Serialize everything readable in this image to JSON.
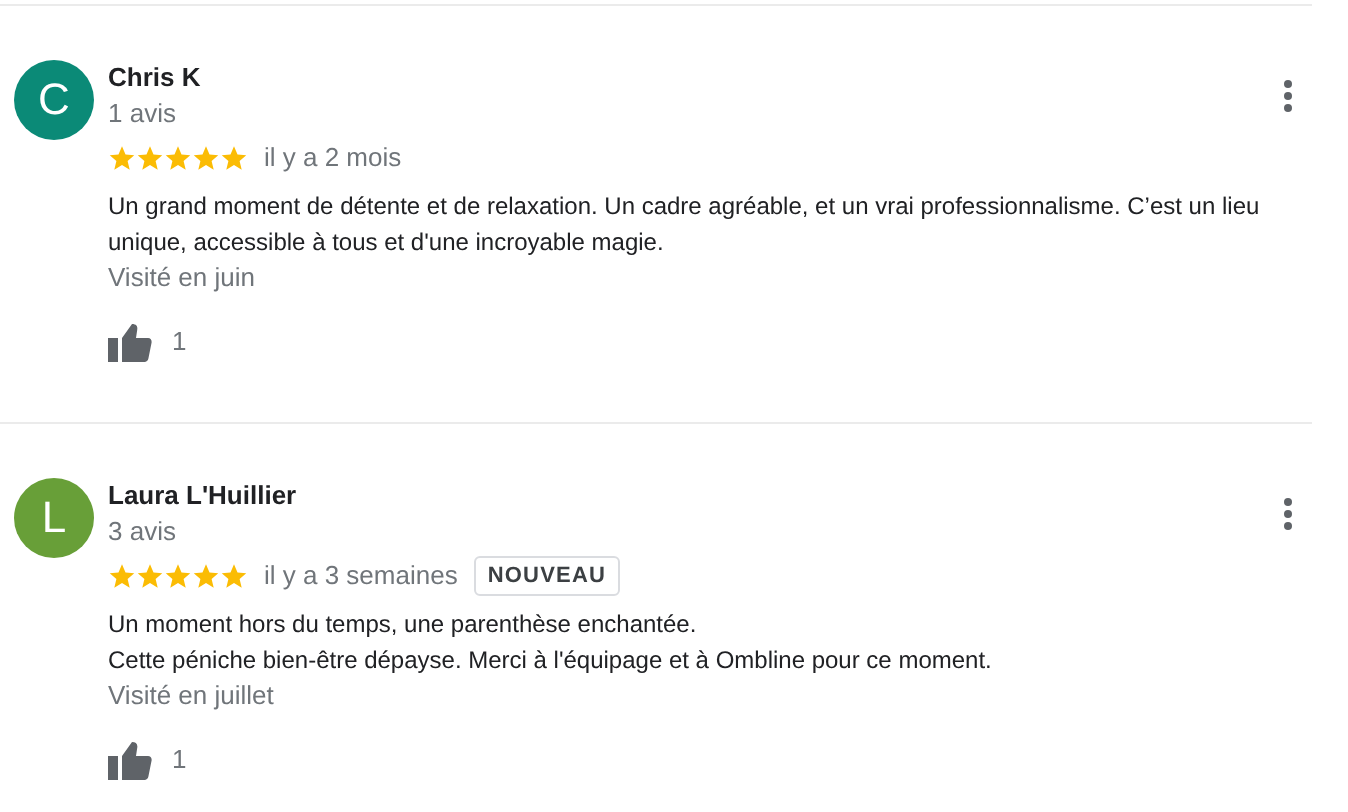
{
  "reviews": [
    {
      "initial": "C",
      "color": "#0b8a77",
      "name": "Chris K",
      "count": "1 avis",
      "stars": 5,
      "date": "il y a 2 mois",
      "body": "Un grand moment de détente et de relaxation. Un cadre agréable, et un vrai professionnalisme. C’est un lieu unique, accessible à tous et d'une incroyable magie.",
      "visited": "Visité en juin",
      "likes": "1"
    },
    {
      "initial": "L",
      "color": "#689f38",
      "name": "Laura L'Huillier",
      "count": "3 avis",
      "stars": 5,
      "date": "il y a 3 semaines",
      "badge": "NOUVEAU",
      "body": "Un moment hors du temps, une parenthèse enchantée.\nCette péniche bien-être dépayse. Merci à l'équipage et à Ombline pour ce moment.",
      "visited": "Visité en juillet",
      "likes": "1"
    }
  ]
}
